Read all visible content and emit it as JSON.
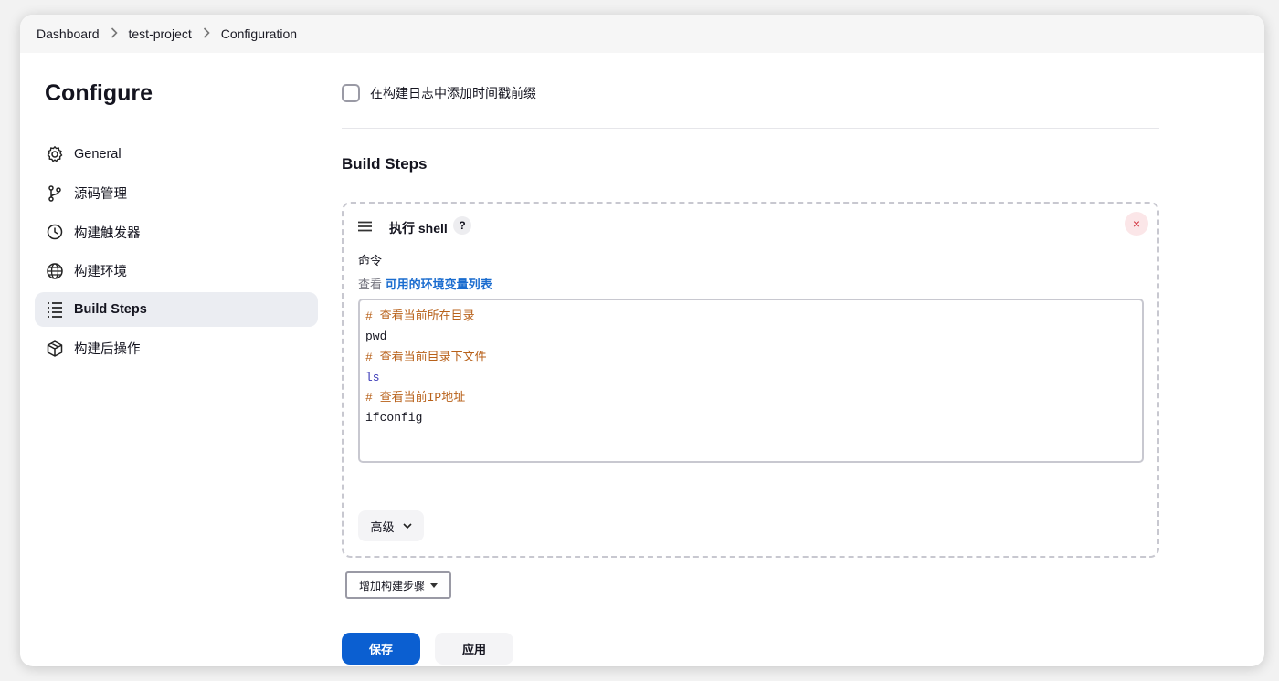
{
  "breadcrumb": {
    "items": [
      "Dashboard",
      "test-project",
      "Configuration"
    ]
  },
  "sidebar": {
    "title": "Configure",
    "items": [
      {
        "label": "General",
        "icon": "gear-icon"
      },
      {
        "label": "源码管理",
        "icon": "git-branch-icon"
      },
      {
        "label": "构建触发器",
        "icon": "timer-icon"
      },
      {
        "label": "构建环境",
        "icon": "globe-icon"
      },
      {
        "label": "Build Steps",
        "icon": "list-icon"
      },
      {
        "label": "构建后操作",
        "icon": "package-icon"
      }
    ]
  },
  "main": {
    "timestamp_checkbox_label": "在构建日志中添加时间戳前缀",
    "build_steps_title": "Build Steps",
    "step": {
      "title": "执行 shell",
      "help": "?",
      "close": "×",
      "command_label": "命令",
      "env_prefix": "查看",
      "env_link": "可用的环境变量列表",
      "code_lines": [
        {
          "text": "# 查看当前所在目录",
          "kind": "comment"
        },
        {
          "text": "pwd",
          "kind": "plain"
        },
        {
          "text": "# 查看当前目录下文件",
          "kind": "comment"
        },
        {
          "text": "ls",
          "kind": "kw"
        },
        {
          "text": "# 查看当前IP地址",
          "kind": "comment"
        },
        {
          "text": "ifconfig",
          "kind": "plain"
        }
      ],
      "advanced_label": "高级"
    },
    "add_step_label": "增加构建步骤"
  },
  "footer": {
    "save_label": "保存",
    "apply_label": "应用"
  },
  "colors": {
    "primary": "#0b5fd1",
    "link": "#1a6ccf",
    "comment": "#b8611a",
    "keyword": "#3b3ab8",
    "danger": "#d2333f"
  }
}
